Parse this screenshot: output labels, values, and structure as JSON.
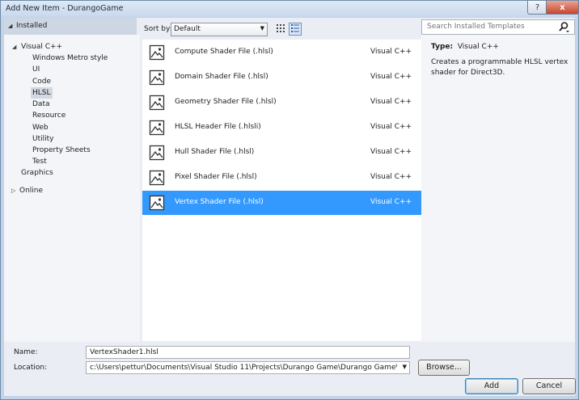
{
  "window": {
    "title": "Add New Item - DurangoGame",
    "help_label": "?",
    "close_label": "x"
  },
  "tree": {
    "header": "Installed",
    "items": [
      {
        "label": "Visual C++"
      },
      {
        "label": "Windows Metro style"
      },
      {
        "label": "UI"
      },
      {
        "label": "Code"
      },
      {
        "label": "HLSL"
      },
      {
        "label": "Data"
      },
      {
        "label": "Resource"
      },
      {
        "label": "Web"
      },
      {
        "label": "Utility"
      },
      {
        "label": "Property Sheets"
      },
      {
        "label": "Test"
      },
      {
        "label": "Graphics"
      },
      {
        "label": "Online"
      }
    ],
    "selected": "HLSL"
  },
  "toolbar": {
    "sort_label": "Sort by:",
    "sort_value": "Default"
  },
  "templates": [
    {
      "name": "Compute Shader File (.hlsl)",
      "lang": "Visual C++"
    },
    {
      "name": "Domain Shader File (.hlsl)",
      "lang": "Visual C++"
    },
    {
      "name": "Geometry Shader File (.hlsl)",
      "lang": "Visual C++"
    },
    {
      "name": "HLSL Header File (.hlsli)",
      "lang": "Visual C++"
    },
    {
      "name": "Hull Shader File (.hlsl)",
      "lang": "Visual C++"
    },
    {
      "name": "Pixel Shader File (.hlsl)",
      "lang": "Visual C++"
    },
    {
      "name": "Vertex Shader File (.hlsl)",
      "lang": "Visual C++"
    }
  ],
  "selected_template": "Vertex Shader File (.hlsl)",
  "details": {
    "search_placeholder": "Search Installed Templates",
    "type_label": "Type:",
    "type_value": "Visual C++",
    "description": "Creates a programmable HLSL vertex shader for Direct3D."
  },
  "form": {
    "name_label": "Name:",
    "name_value": "VertexShader1.hlsl",
    "location_label": "Location:",
    "location_value": "c:\\Users\\pettur\\Documents\\Visual Studio 11\\Projects\\Durango Game\\Durango Game\\",
    "browse_label": "Browse...",
    "add_label": "Add",
    "cancel_label": "Cancel"
  },
  "colors": {
    "selection": "#3399ff",
    "tree_selection": "#d2d9e2"
  }
}
